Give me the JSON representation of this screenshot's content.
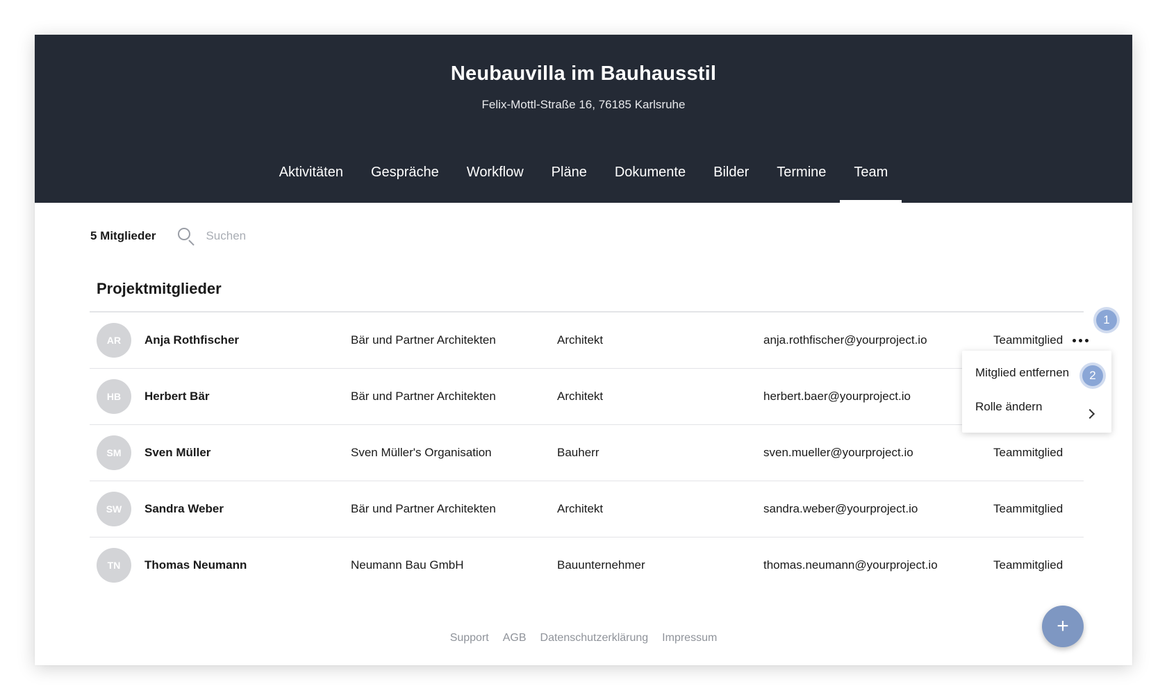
{
  "project": {
    "title": "Neubauvilla im Bauhausstil",
    "address": "Felix-Mottl-Straße 16, 76185 Karlsruhe"
  },
  "tabs": [
    {
      "label": "Aktivitäten",
      "active": false
    },
    {
      "label": "Gespräche",
      "active": false
    },
    {
      "label": "Workflow",
      "active": false
    },
    {
      "label": "Pläne",
      "active": false
    },
    {
      "label": "Dokumente",
      "active": false
    },
    {
      "label": "Bilder",
      "active": false
    },
    {
      "label": "Termine",
      "active": false
    },
    {
      "label": "Team",
      "active": true
    }
  ],
  "toolbar": {
    "member_count": "5 Mitglieder",
    "search_placeholder": "Suchen",
    "search_value": ""
  },
  "section": {
    "title": "Projektmitglieder"
  },
  "members": [
    {
      "initials": "AR",
      "name": "Anja Rothfischer",
      "organization": "Bär und Partner Architekten",
      "role": "Architekt",
      "email": "anja.rothfischer@yourproject.io",
      "status": "Teammitglied"
    },
    {
      "initials": "HB",
      "name": "Herbert Bär",
      "organization": "Bär und Partner Architekten",
      "role": "Architekt",
      "email": "herbert.baer@yourproject.io",
      "status": ""
    },
    {
      "initials": "SM",
      "name": "Sven Müller",
      "organization": "Sven Müller's Organisation",
      "role": "Bauherr",
      "email": "sven.mueller@yourproject.io",
      "status": "Teammitglied"
    },
    {
      "initials": "SW",
      "name": "Sandra Weber",
      "organization": "Bär und Partner Architekten",
      "role": "Architekt",
      "email": "sandra.weber@yourproject.io",
      "status": "Teammitglied"
    },
    {
      "initials": "TN",
      "name": "Thomas Neumann",
      "organization": "Neumann Bau GmbH",
      "role": "Bauunternehmer",
      "email": "thomas.neumann@yourproject.io",
      "status": "Teammitglied"
    }
  ],
  "menu": {
    "remove_label": "Mitglied entfernen",
    "change_role_label": "Rolle ändern"
  },
  "badges": {
    "step1": "1",
    "step2": "2"
  },
  "fab": {
    "label": "+"
  },
  "footer": {
    "links": [
      "Support",
      "AGB",
      "Datenschutzerklärung",
      "Impressum"
    ]
  },
  "colors": {
    "header_bg": "#242a35",
    "accent": "#7e97c2",
    "badge": "#8aa6d6",
    "avatar_bg": "#d3d4d7"
  }
}
